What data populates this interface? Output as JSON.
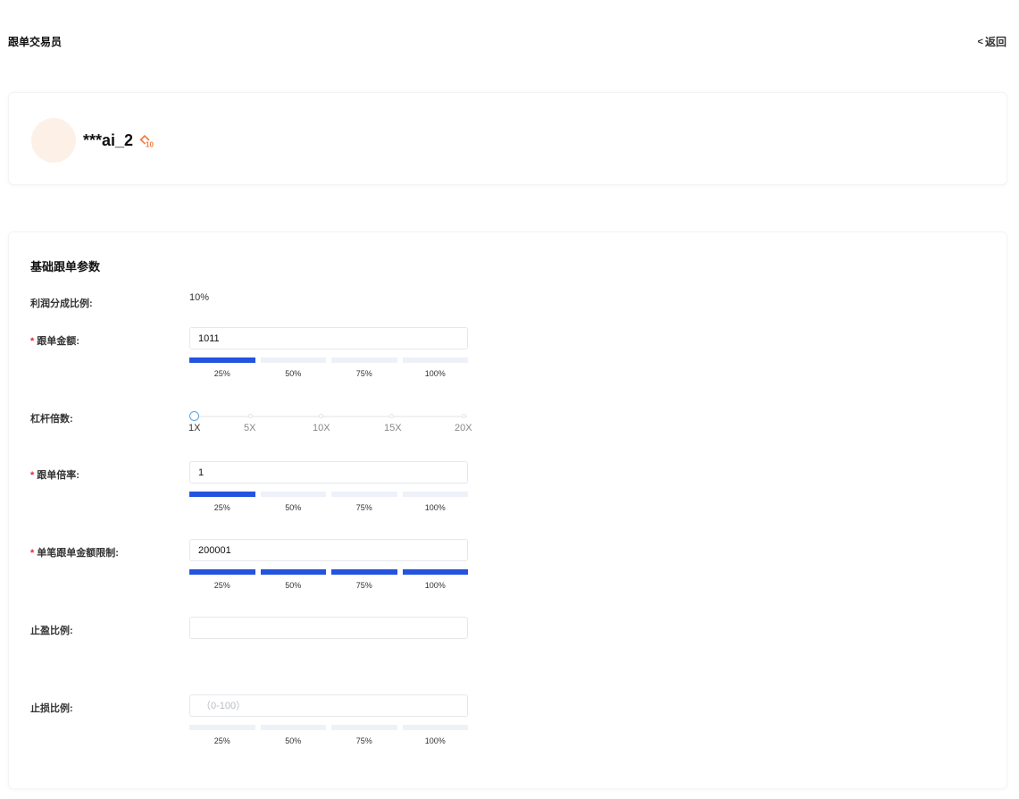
{
  "header": {
    "title": "跟单交易员",
    "back_chevron": "<",
    "back_label": "返回"
  },
  "trader": {
    "name": "***ai_2",
    "badge_icon": "trader-rank-badge-icon",
    "badge_level": "10",
    "badge_color": "#f07b3f"
  },
  "params": {
    "section_title": "基础跟单参数",
    "profit_share": {
      "label": "利润分成比例:",
      "value": "10%"
    },
    "copy_amount": {
      "label": "跟单金额:",
      "required_mark": "*",
      "value": "1011",
      "percent_active": 1
    },
    "leverage": {
      "label": "杠杆倍数:",
      "ticks": [
        "1X",
        "5X",
        "10X",
        "15X",
        "20X"
      ],
      "selected_index": 0
    },
    "copy_ratio": {
      "label": "跟单倍率:",
      "required_mark": "*",
      "value": "1",
      "percent_active": 1
    },
    "single_limit": {
      "label": "单笔跟单金额限制:",
      "required_mark": "*",
      "value": "200001",
      "percent_active": 4
    },
    "take_profit": {
      "label": "止盈比例:",
      "value": "",
      "placeholder": ""
    },
    "stop_loss": {
      "label": "止损比例:",
      "value": "",
      "placeholder": "（0-100）",
      "percent_active": 0
    },
    "percent_options": [
      "25%",
      "50%",
      "75%",
      "100%"
    ]
  },
  "colors": {
    "accent": "#2453e0",
    "required": "#f5222d",
    "slider_handle": "#59a6e6"
  }
}
